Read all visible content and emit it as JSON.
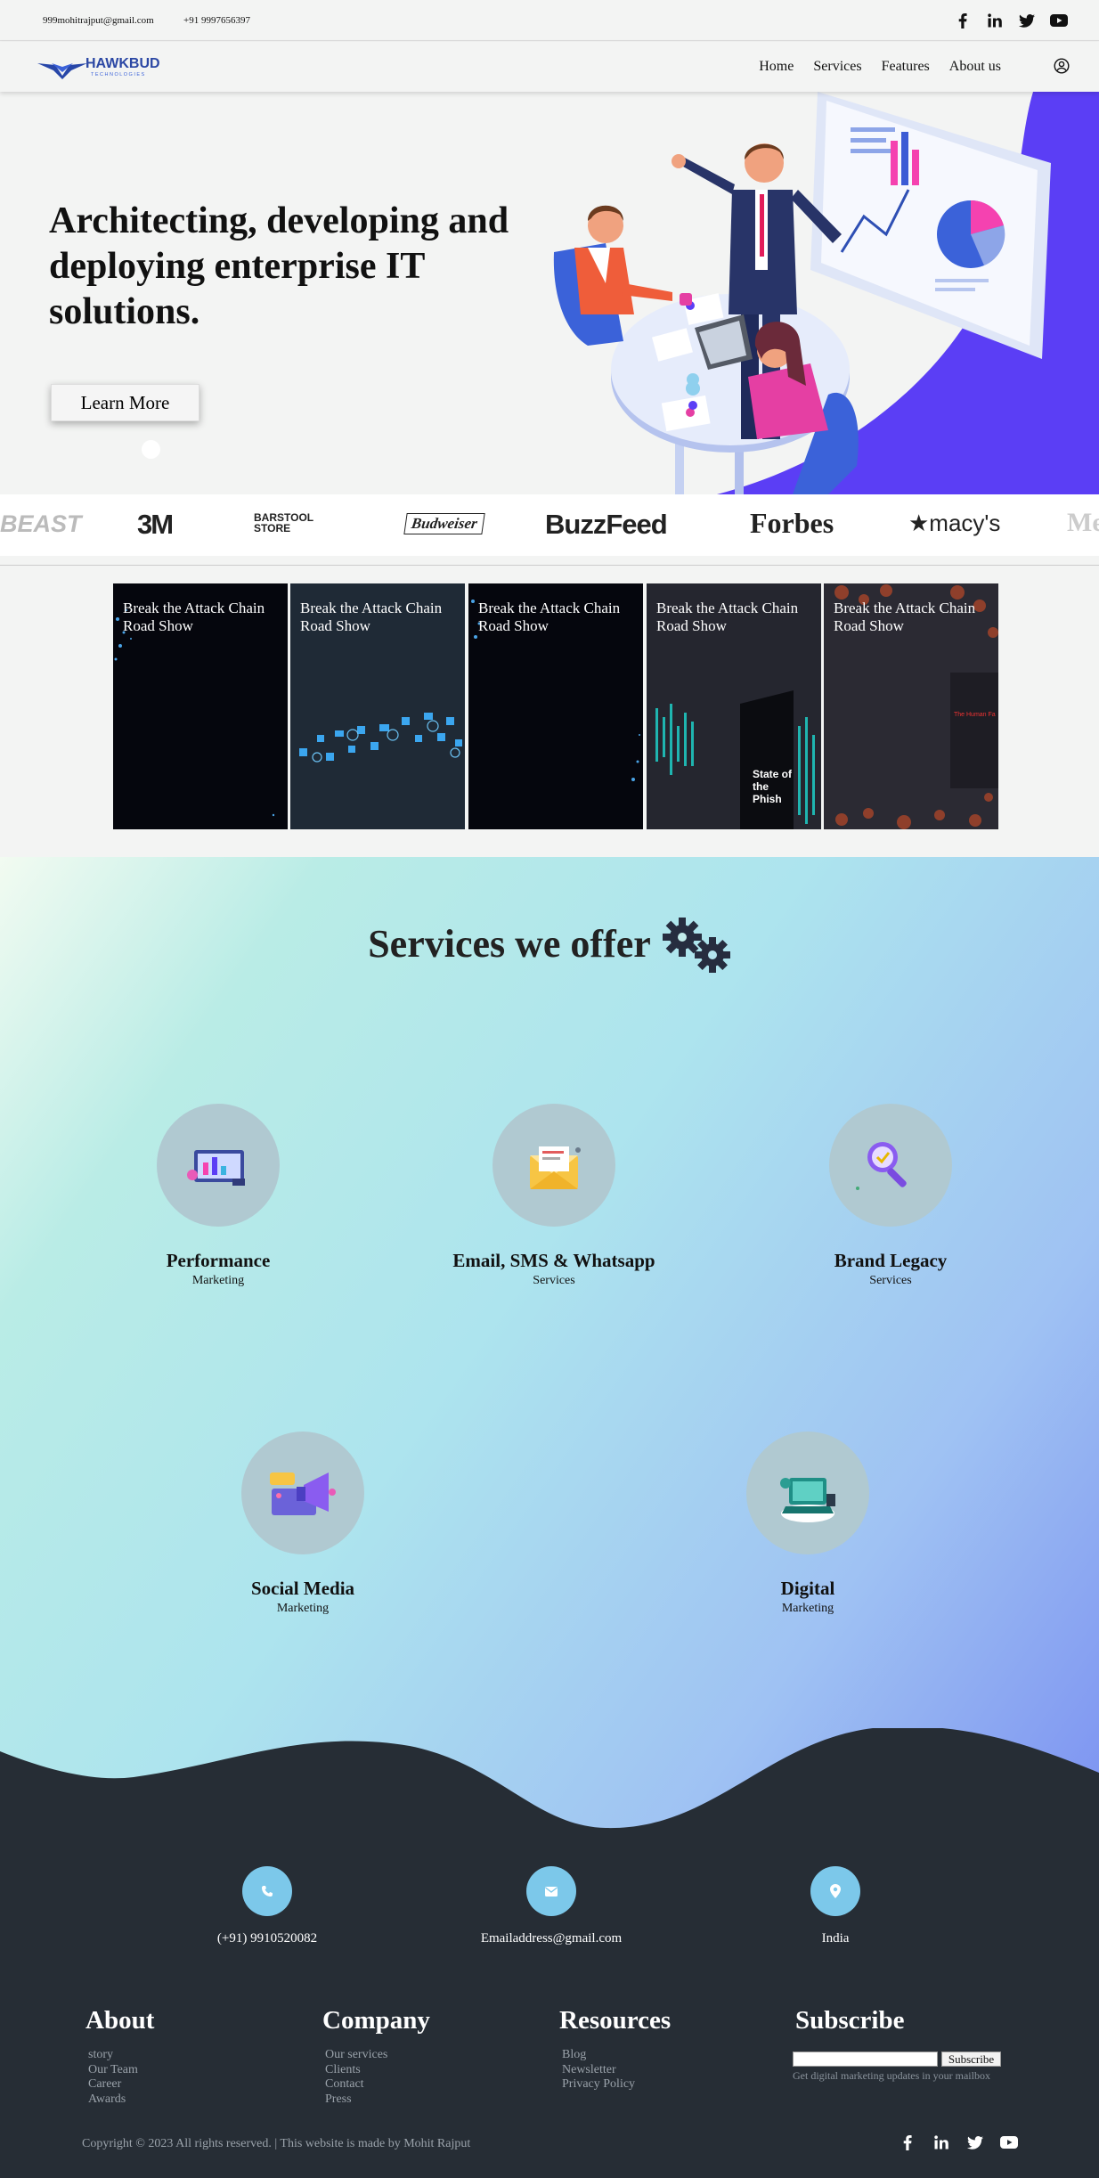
{
  "topbar": {
    "email": "999mohitrajput@gmail.com",
    "phone": "+91 9997656397",
    "social": [
      "facebook-icon",
      "linkedin-icon",
      "twitter-icon",
      "youtube-icon"
    ]
  },
  "navbar": {
    "logo_text": "HAWKBUD",
    "logo_subtext": "TECHNOLOGIES",
    "items": [
      {
        "label": "Home"
      },
      {
        "label": "Services"
      },
      {
        "label": "Features"
      },
      {
        "label": "About us"
      }
    ],
    "user_icon": "user-circle-icon"
  },
  "hero": {
    "headline": "Architecting, developing and deploying enterprise IT solutions.",
    "button_label": "Learn More",
    "accent_color": "#5b3ef5"
  },
  "brands": [
    "BEAST",
    "3M",
    "BARSTOOL STORE",
    "Budweiser",
    "BuzzFeed",
    "Forbes",
    "★macy's",
    "Me"
  ],
  "cards": [
    {
      "title": "Break the Attack Chain Road Show"
    },
    {
      "title": "Break the Attack Chain Road Show"
    },
    {
      "title": "Break the Attack Chain Road Show"
    },
    {
      "title": "Break the Attack Chain Road Show",
      "inner_text": "State of the Phish"
    },
    {
      "title": "Break the Attack Chain Road Show",
      "inner_text": "The Human Fa"
    }
  ],
  "services": {
    "title": "Services we offer",
    "items": [
      {
        "name": "Performance",
        "sub": "Marketing",
        "icon": "dashboard-icon"
      },
      {
        "name": "Email, SMS & Whatsapp",
        "sub": "Services",
        "icon": "envelope-icon"
      },
      {
        "name": "Brand Legacy",
        "sub": "Services",
        "icon": "magnifier-icon"
      },
      {
        "name": "Social Media",
        "sub": "Marketing",
        "icon": "megaphone-icon"
      },
      {
        "name": "Digital",
        "sub": "Marketing",
        "icon": "laptop-icon"
      }
    ]
  },
  "contact": [
    {
      "icon": "phone-icon",
      "text": "(+91) 9910520082"
    },
    {
      "icon": "mail-icon",
      "text": "Emailaddress@gmail.com"
    },
    {
      "icon": "location-pin-icon",
      "text": "India"
    }
  ],
  "footer": {
    "about": {
      "title": "About",
      "links": [
        "story",
        "Our Team",
        "Career",
        "Awards"
      ]
    },
    "company": {
      "title": "Company",
      "links": [
        "Our services",
        "Clients",
        "Contact",
        "Press"
      ]
    },
    "resources": {
      "title": "Resources",
      "links": [
        "Blog",
        "Newsletter",
        "Privacy Policy"
      ]
    },
    "subscribe": {
      "title": "Subscribe",
      "button": "Subscribe",
      "hint": "Get digital marketing updates in your mailbox"
    },
    "copyright": "Copyright © 2023 All rights reserved. | This website is made by Mohit Rajput",
    "social": [
      "facebook-icon",
      "linkedin-icon",
      "twitter-icon",
      "youtube-icon"
    ],
    "bg_color": "#262d35"
  }
}
